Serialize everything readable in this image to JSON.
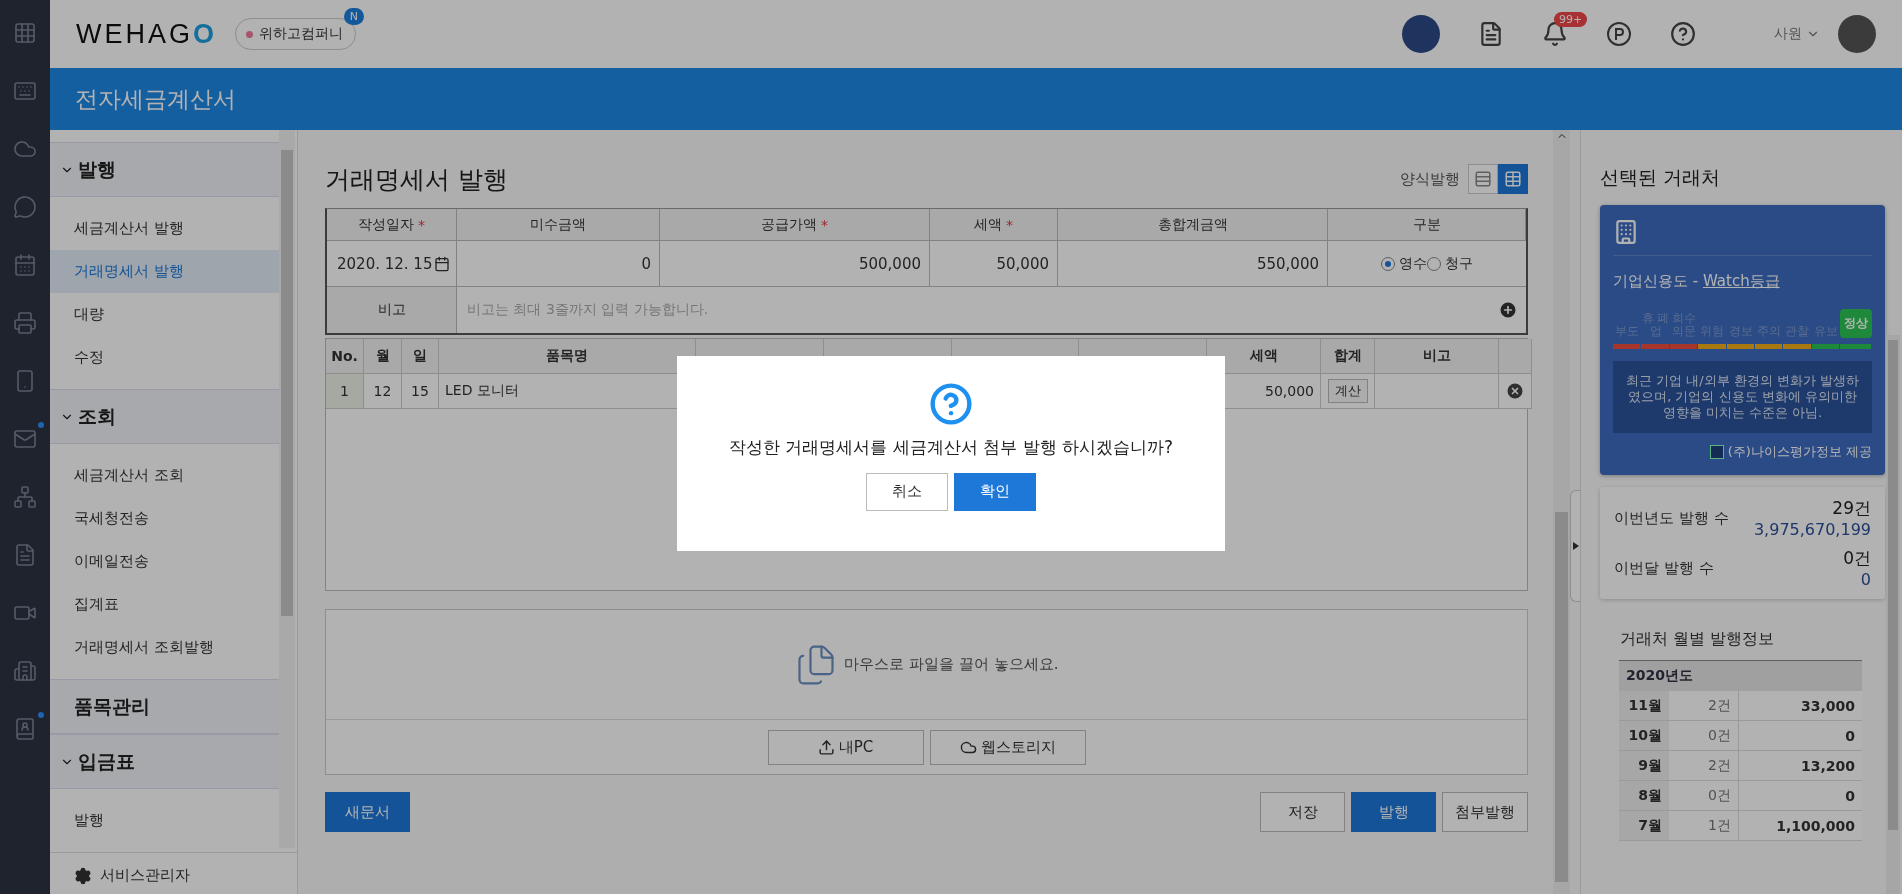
{
  "app": {
    "logo": "WEHAGO",
    "company": "위하고컴퍼니",
    "company_badge": "N",
    "notification_count": "99+",
    "user_role": "사원",
    "service_title": "전자세금계산서"
  },
  "rail": [
    {
      "kind": "apps",
      "alert": false
    },
    {
      "kind": "keyboard",
      "alert": false
    },
    {
      "kind": "cloud",
      "alert": false
    },
    {
      "kind": "chat",
      "alert": false
    },
    {
      "kind": "calendar",
      "alert": false
    },
    {
      "kind": "printer",
      "alert": false
    },
    {
      "kind": "phone",
      "alert": false
    },
    {
      "kind": "mail",
      "alert": true
    },
    {
      "kind": "org",
      "alert": false
    },
    {
      "kind": "document",
      "alert": false
    },
    {
      "kind": "video",
      "alert": false
    },
    {
      "kind": "building",
      "alert": false
    },
    {
      "kind": "contacts",
      "alert": true
    }
  ],
  "sidebar": {
    "sections": [
      {
        "title": "발행",
        "kind": "group",
        "expanded": true,
        "items": [
          {
            "label": "세금계산서 발행",
            "selected": false
          },
          {
            "label": "거래명세서 발행",
            "selected": true
          },
          {
            "label": "대량",
            "selected": false
          },
          {
            "label": "수정",
            "selected": false
          }
        ]
      },
      {
        "title": "조회",
        "kind": "group",
        "expanded": true,
        "items": [
          {
            "label": "세금계산서 조회",
            "selected": false
          },
          {
            "label": "국세청전송",
            "selected": false
          },
          {
            "label": "이메일전송",
            "selected": false
          },
          {
            "label": "집계표",
            "selected": false
          },
          {
            "label": "거래명세서 조회발행",
            "selected": false
          }
        ]
      },
      {
        "title": "품목관리",
        "kind": "link"
      },
      {
        "title": "입금표",
        "kind": "group",
        "expanded": true,
        "items": [
          {
            "label": "발행",
            "selected": false
          }
        ]
      }
    ],
    "footer": "서비스관리자"
  },
  "page": {
    "title": "거래명세서 발행",
    "form_mode_label": "양식발행",
    "view_modes": [
      {
        "kind": "form",
        "selected": false
      },
      {
        "kind": "grid",
        "selected": true
      }
    ]
  },
  "summary": {
    "required_mark": "*",
    "columns": [
      {
        "label": "작성일자",
        "required": true
      },
      {
        "label": "미수금액",
        "required": false
      },
      {
        "label": "공급가액",
        "required": true
      },
      {
        "label": "세액",
        "required": true
      },
      {
        "label": "총합계금액",
        "required": false
      },
      {
        "label": "구분",
        "required": false
      }
    ],
    "date": "2020. 12. 15",
    "unpaid": "0",
    "supply": "500,000",
    "tax": "50,000",
    "total": "550,000",
    "types": [
      {
        "label": "영수",
        "selected": true
      },
      {
        "label": "청구",
        "selected": false
      }
    ],
    "note_label": "비고",
    "note_placeholder": "비고는 최대 3줄까지 입력 가능합니다."
  },
  "items": {
    "columns": [
      {
        "label": "No."
      },
      {
        "label": "월"
      },
      {
        "label": "일"
      },
      {
        "label": "품목명"
      },
      {
        "kind": "covered"
      },
      {
        "kind": "covered"
      },
      {
        "kind": "covered"
      },
      {
        "kind": "covered"
      },
      {
        "label": "세액"
      },
      {
        "label": "합계"
      },
      {
        "label": "비고"
      }
    ],
    "rows": [
      {
        "no": "1",
        "month": "12",
        "day": "15",
        "name": "LED 모니터",
        "tax": "50,000",
        "action": "계산"
      }
    ]
  },
  "attachments": {
    "hint": "마우스로 파일을 끌어 놓으세요.",
    "buttons": [
      {
        "kind": "upload",
        "label": "내PC"
      },
      {
        "kind": "cloud",
        "label": "웹스토리지"
      }
    ]
  },
  "actions": {
    "left": [
      {
        "label": "새문서",
        "primary": true
      }
    ],
    "right": [
      {
        "label": "저장",
        "primary": false
      },
      {
        "label": "발행",
        "primary": true
      },
      {
        "label": "첨부발행",
        "primary": false
      }
    ]
  },
  "partner": {
    "title": "선택된 거래처",
    "credit_label": "기업신용도 - ",
    "credit_link": "Watch등급",
    "grades": [
      {
        "label": "부도",
        "color": "#a8352d",
        "selected": false
      },
      {
        "label": "휴 폐업",
        "color": "#a8352d",
        "selected": false
      },
      {
        "label": "회수 의문",
        "color": "#a8352d",
        "selected": false
      },
      {
        "label": "위험",
        "color": "#a87a10",
        "selected": false
      },
      {
        "label": "경보",
        "color": "#a87a10",
        "selected": false
      },
      {
        "label": "주의",
        "color": "#a87a10",
        "selected": false
      },
      {
        "label": "관찰",
        "color": "#a87a10",
        "selected": false
      },
      {
        "label": "유보",
        "color": "#1f8a3a",
        "selected": false
      },
      {
        "label": "정상",
        "color": "#1f8a3a",
        "selected": true
      }
    ],
    "description": "최근 기업 내/외부 환경의 변화가 발생하였으며, 기업의 신용도 변화에 유의미한 영향을 미치는 수준은 아님.",
    "provider": "(주)나이스평가정보 제공",
    "stats": [
      {
        "label": "이번년도 발행 수",
        "count": "29건",
        "amount": "3,975,670,199"
      },
      {
        "label": "이번달 발행 수",
        "count": "0건",
        "amount": "0"
      }
    ],
    "monthly_title": "거래처 월별 발행정보",
    "year": "2020년도",
    "months": [
      {
        "month": "11월",
        "count": "2건",
        "amount": "33,000"
      },
      {
        "month": "10월",
        "count": "0건",
        "amount": "0"
      },
      {
        "month": "9월",
        "count": "2건",
        "amount": "13,200"
      },
      {
        "month": "8월",
        "count": "0건",
        "amount": "0"
      },
      {
        "month": "7월",
        "count": "1건",
        "amount": "1,100,000"
      }
    ]
  },
  "dialog": {
    "message": "작성한 거래명세서를 세금계산서 첨부 발행 하시겠습니까?",
    "buttons": [
      {
        "label": "취소",
        "primary": false
      },
      {
        "label": "확인",
        "primary": true
      }
    ]
  }
}
